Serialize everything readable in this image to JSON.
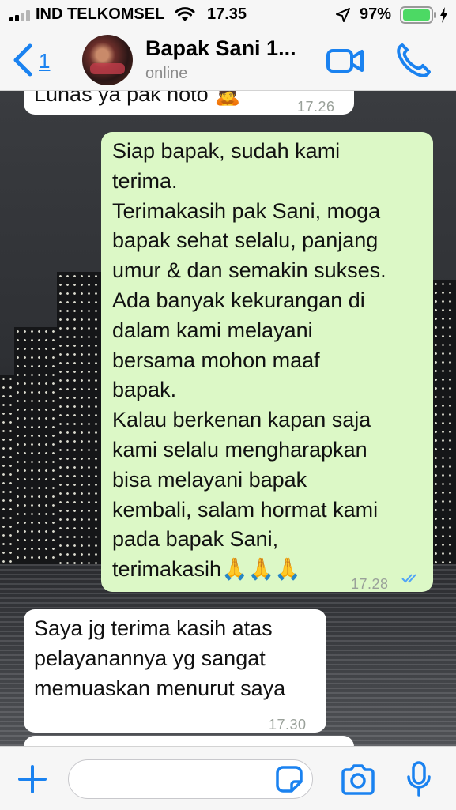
{
  "status_bar": {
    "carrier": "IND TELKOMSEL",
    "time": "17.35",
    "battery": "97%"
  },
  "header": {
    "back_count": "1",
    "contact_name": "Bapak Sani 1...",
    "contact_status": "online"
  },
  "messages": [
    {
      "direction": "incoming",
      "text": "Lunas ya pak hoto 🙇",
      "time": "17.26"
    },
    {
      "direction": "outgoing",
      "text": "Siap bapak, sudah kami\nterima.\nTerimakasih pak Sani, moga\nbapak sehat selalu, panjang\numur & dan semakin sukses.\nAda banyak kekurangan di\ndalam kami melayani\nbersama mohon maaf\nbapak.\nKalau berkenan kapan saja\nkami selalu mengharapkan\nbisa melayani bapak\nkembali, salam hormat kami\npada bapak Sani,\nterimakasih🙏🙏🙏",
      "time": "17.28",
      "read": true
    },
    {
      "direction": "incoming",
      "text": "Saya jg terima kasih atas\npelayanannya yg sangat\nmemuaskan menurut saya",
      "time": "17.30"
    }
  ],
  "colors": {
    "accent": "#1a82f0",
    "outgoing_bubble": "#dcf8c6",
    "incoming_bubble": "#ffffff",
    "read_ticks": "#4fa3f7"
  },
  "icons": {
    "back": "chevron-left-icon",
    "video": "video-camera-icon",
    "call": "phone-icon",
    "attach": "plus-icon",
    "sticker": "sticker-icon",
    "camera": "camera-icon",
    "mic": "microphone-icon"
  }
}
